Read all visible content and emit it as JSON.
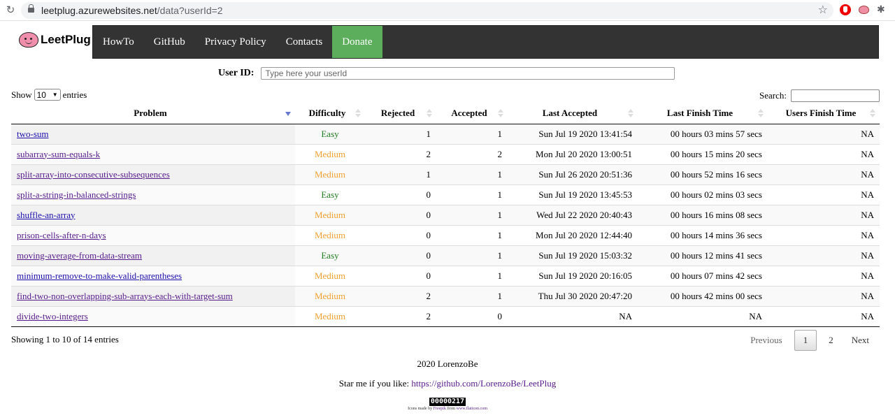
{
  "browser": {
    "url_host": "leetplug.azurewebsites.net",
    "url_path": "/data?userId=2"
  },
  "header": {
    "logo_text": "LeetPlug",
    "nav": [
      {
        "label": "HowTo"
      },
      {
        "label": "GitHub"
      },
      {
        "label": "Privacy Policy"
      },
      {
        "label": "Contacts"
      },
      {
        "label": "Donate"
      }
    ],
    "accent_color": "#5cad5c"
  },
  "userid": {
    "label": "User ID:",
    "placeholder": "Type here your userId",
    "value": ""
  },
  "table_controls": {
    "show_label": "Show",
    "entries_label": "entries",
    "page_length": "10",
    "search_label": "Search:",
    "search_value": ""
  },
  "table": {
    "columns": [
      "Problem",
      "Difficulty",
      "Rejected",
      "Accepted",
      "Last Accepted",
      "Last Finish Time",
      "Users Finish Time"
    ],
    "sorted_column": "Problem",
    "rows": [
      {
        "problem": "two-sum",
        "difficulty": "Easy",
        "rejected": "1",
        "accepted": "1",
        "last_accepted": "Sun Jul 19 2020 13:41:54",
        "last_finish": "00 hours 03 mins 57 secs",
        "users_finish": "NA"
      },
      {
        "problem": "subarray-sum-equals-k",
        "difficulty": "Medium",
        "rejected": "2",
        "accepted": "2",
        "last_accepted": "Mon Jul 20 2020 13:00:51",
        "last_finish": "00 hours 15 mins 20 secs",
        "users_finish": "NA"
      },
      {
        "problem": "split-array-into-consecutive-subsequences",
        "difficulty": "Medium",
        "rejected": "1",
        "accepted": "1",
        "last_accepted": "Sun Jul 26 2020 20:51:36",
        "last_finish": "00 hours 52 mins 16 secs",
        "users_finish": "NA"
      },
      {
        "problem": "split-a-string-in-balanced-strings",
        "difficulty": "Easy",
        "rejected": "0",
        "accepted": "1",
        "last_accepted": "Sun Jul 19 2020 13:45:53",
        "last_finish": "00 hours 02 mins 03 secs",
        "users_finish": "NA"
      },
      {
        "problem": "shuffle-an-array",
        "difficulty": "Medium",
        "rejected": "0",
        "accepted": "1",
        "last_accepted": "Wed Jul 22 2020 20:40:43",
        "last_finish": "00 hours 16 mins 08 secs",
        "users_finish": "NA"
      },
      {
        "problem": "prison-cells-after-n-days",
        "difficulty": "Medium",
        "rejected": "0",
        "accepted": "1",
        "last_accepted": "Mon Jul 20 2020 12:44:40",
        "last_finish": "00 hours 14 mins 36 secs",
        "users_finish": "NA"
      },
      {
        "problem": "moving-average-from-data-stream",
        "difficulty": "Easy",
        "rejected": "0",
        "accepted": "1",
        "last_accepted": "Sun Jul 19 2020 15:03:32",
        "last_finish": "00 hours 12 mins 41 secs",
        "users_finish": "NA"
      },
      {
        "problem": "minimum-remove-to-make-valid-parentheses",
        "difficulty": "Medium",
        "rejected": "0",
        "accepted": "1",
        "last_accepted": "Sun Jul 19 2020 20:16:05",
        "last_finish": "00 hours 07 mins 42 secs",
        "users_finish": "NA"
      },
      {
        "problem": "find-two-non-overlapping-sub-arrays-each-with-target-sum",
        "difficulty": "Medium",
        "rejected": "2",
        "accepted": "1",
        "last_accepted": "Thu Jul 30 2020 20:47:20",
        "last_finish": "00 hours 42 mins 00 secs",
        "users_finish": "NA"
      },
      {
        "problem": "divide-two-integers",
        "difficulty": "Medium",
        "rejected": "2",
        "accepted": "0",
        "last_accepted": "NA",
        "last_finish": "NA",
        "users_finish": "NA"
      }
    ]
  },
  "table_info": "Showing 1 to 10 of 14 entries",
  "pagination": {
    "previous": "Previous",
    "pages": [
      "1",
      "2"
    ],
    "current": "1",
    "next": "Next"
  },
  "footer": {
    "copyright": "2020 LorenzoBe",
    "star_text": "Star me if you like: ",
    "star_link": "https://github.com/LorenzoBe/LeetPlug",
    "counter": "00000217",
    "credits_prefix": "Icons made by ",
    "credits_author": "Freepik",
    "credits_mid": " from ",
    "credits_site": "www.flaticon.com"
  },
  "colors": {
    "easy": "#1e7d1e",
    "medium": "#f0a030",
    "navbar": "#333333"
  }
}
